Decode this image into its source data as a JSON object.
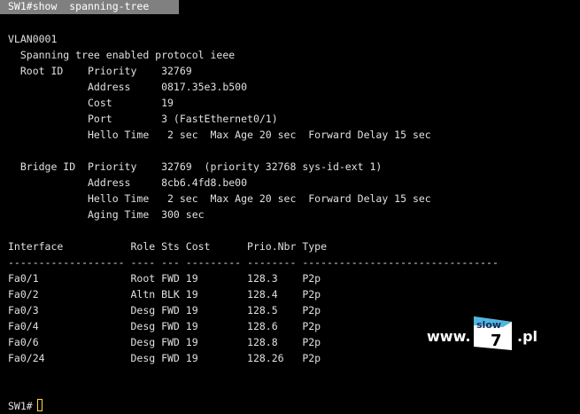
{
  "prompt_command": "SW1#show  spanning-tree",
  "vlan": "VLAN0001",
  "protocol_line": "  Spanning tree enabled protocol ieee",
  "root": {
    "priority": "  Root ID    Priority    32769",
    "address": "             Address     0817.35e3.b500",
    "cost": "             Cost        19",
    "port": "             Port        3 (FastEthernet0/1)",
    "hello": "             Hello Time   2 sec  Max Age 20 sec  Forward Delay 15 sec"
  },
  "bridge": {
    "priority": "  Bridge ID  Priority    32769  (priority 32768 sys-id-ext 1)",
    "address": "             Address     8cb6.4fd8.be00",
    "hello": "             Hello Time   2 sec  Max Age 20 sec  Forward Delay 15 sec",
    "aging": "             Aging Time  300 sec"
  },
  "table": {
    "header": "Interface           Role Sts Cost      Prio.Nbr Type",
    "separator": "------------------- ---- --- --------- -------- --------------------------------",
    "rows": [
      "Fa0/1               Root FWD 19        128.3    P2p",
      "Fa0/2               Altn BLK 19        128.4    P2p",
      "Fa0/3               Desg FWD 19        128.5    P2p",
      "Fa0/4               Desg FWD 19        128.6    P2p",
      "Fa0/6               Desg FWD 19        128.8    P2p",
      "Fa0/24              Desg FWD 19        128.26   P2p"
    ]
  },
  "final_prompt": "SW1#",
  "watermark": {
    "prefix": "www.",
    "logo_text": "slow",
    "logo_digit": "7",
    "suffix": ".pl"
  }
}
